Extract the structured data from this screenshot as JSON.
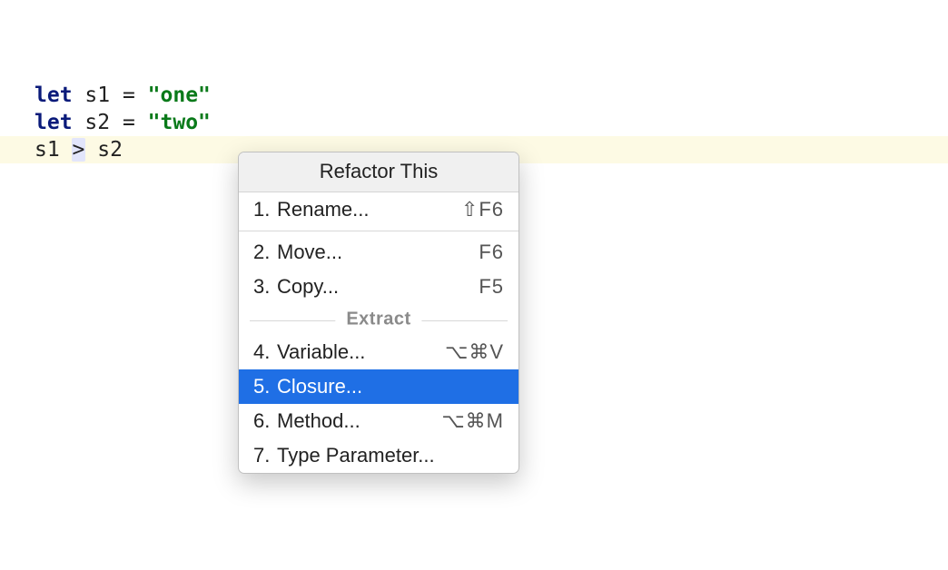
{
  "editor": {
    "lines": [
      {
        "tokens": [
          {
            "cls": "kw",
            "t": "let"
          },
          {
            "cls": "id",
            "t": " s1 "
          },
          {
            "cls": "op",
            "t": "="
          },
          {
            "cls": "id",
            "t": " "
          },
          {
            "cls": "str",
            "t": "\"one\""
          }
        ],
        "highlighted": false
      },
      {
        "tokens": [
          {
            "cls": "kw",
            "t": "let"
          },
          {
            "cls": "id",
            "t": " s2 "
          },
          {
            "cls": "op",
            "t": "="
          },
          {
            "cls": "id",
            "t": " "
          },
          {
            "cls": "str",
            "t": "\"two\""
          }
        ],
        "highlighted": false
      },
      {
        "tokens": [
          {
            "cls": "id",
            "t": "s1 "
          },
          {
            "cls": "op",
            "t": ">",
            "selected": true
          },
          {
            "cls": "id",
            "t": " s2"
          }
        ],
        "highlighted": true
      }
    ]
  },
  "popup": {
    "title": "Refactor This",
    "groupLabel": "Extract",
    "items": [
      {
        "n": "1.",
        "label": "Rename...",
        "shortcut": "⇧F6",
        "selected": false,
        "group": 0
      },
      {
        "n": "2.",
        "label": "Move...",
        "shortcut": "F6",
        "selected": false,
        "group": 1
      },
      {
        "n": "3.",
        "label": "Copy...",
        "shortcut": "F5",
        "selected": false,
        "group": 1
      },
      {
        "n": "4.",
        "label": "Variable...",
        "shortcut": "⌥⌘V",
        "selected": false,
        "group": 2
      },
      {
        "n": "5.",
        "label": "Closure...",
        "shortcut": "",
        "selected": true,
        "group": 2
      },
      {
        "n": "6.",
        "label": "Method...",
        "shortcut": "⌥⌘M",
        "selected": false,
        "group": 2
      },
      {
        "n": "7.",
        "label": "Type Parameter...",
        "shortcut": "",
        "selected": false,
        "group": 2
      }
    ]
  }
}
